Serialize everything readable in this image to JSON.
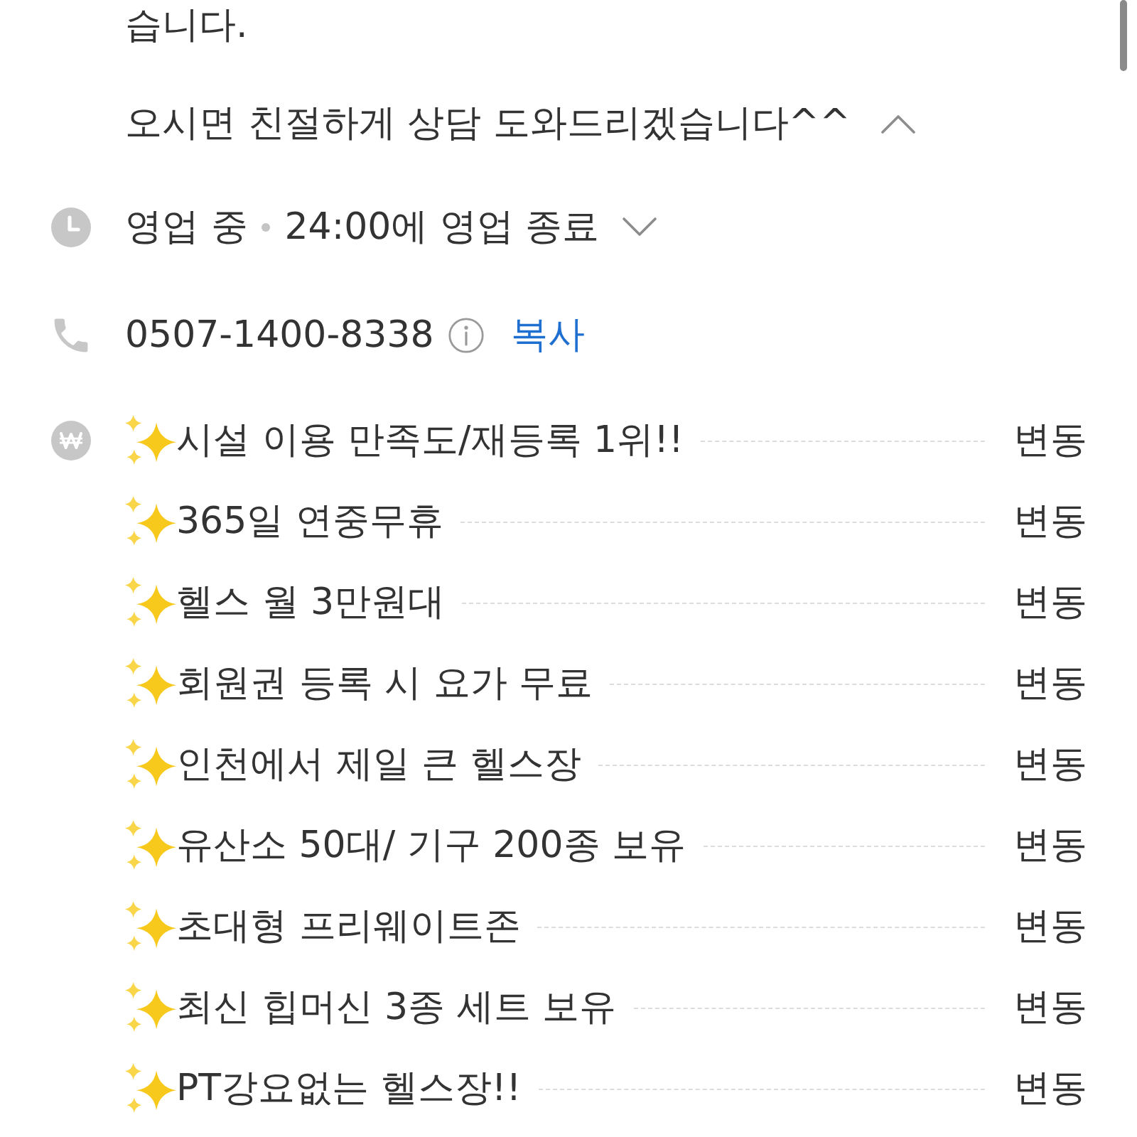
{
  "description": {
    "paragraphs": [
      "습니다.",
      "오시면 친절하게 상담 도와드리겠습니다^^"
    ],
    "expanded": true
  },
  "hours": {
    "status": "영업 중",
    "closing": "24:00에 영업 종료",
    "expanded": false
  },
  "phone": {
    "number": "0507-1400-8338",
    "copy_label": "복사"
  },
  "menu": [
    {
      "name": "시설 이용 만족도/재등록 1위!!",
      "price": "변동"
    },
    {
      "name": "365일 연중무휴",
      "price": "변동"
    },
    {
      "name": "헬스 월 3만원대",
      "price": "변동"
    },
    {
      "name": "회원권 등록 시 요가 무료",
      "price": "변동"
    },
    {
      "name": "인천에서 제일 큰 헬스장",
      "price": "변동"
    },
    {
      "name": "유산소 50대/ 기구 200종 보유",
      "price": "변동"
    },
    {
      "name": "초대형 프리웨이트존",
      "price": "변동"
    },
    {
      "name": "최신 힙머신 3종 세트 보유",
      "price": "변동"
    },
    {
      "name": "PT강요없는 헬스장!!",
      "price": "변동"
    }
  ]
}
